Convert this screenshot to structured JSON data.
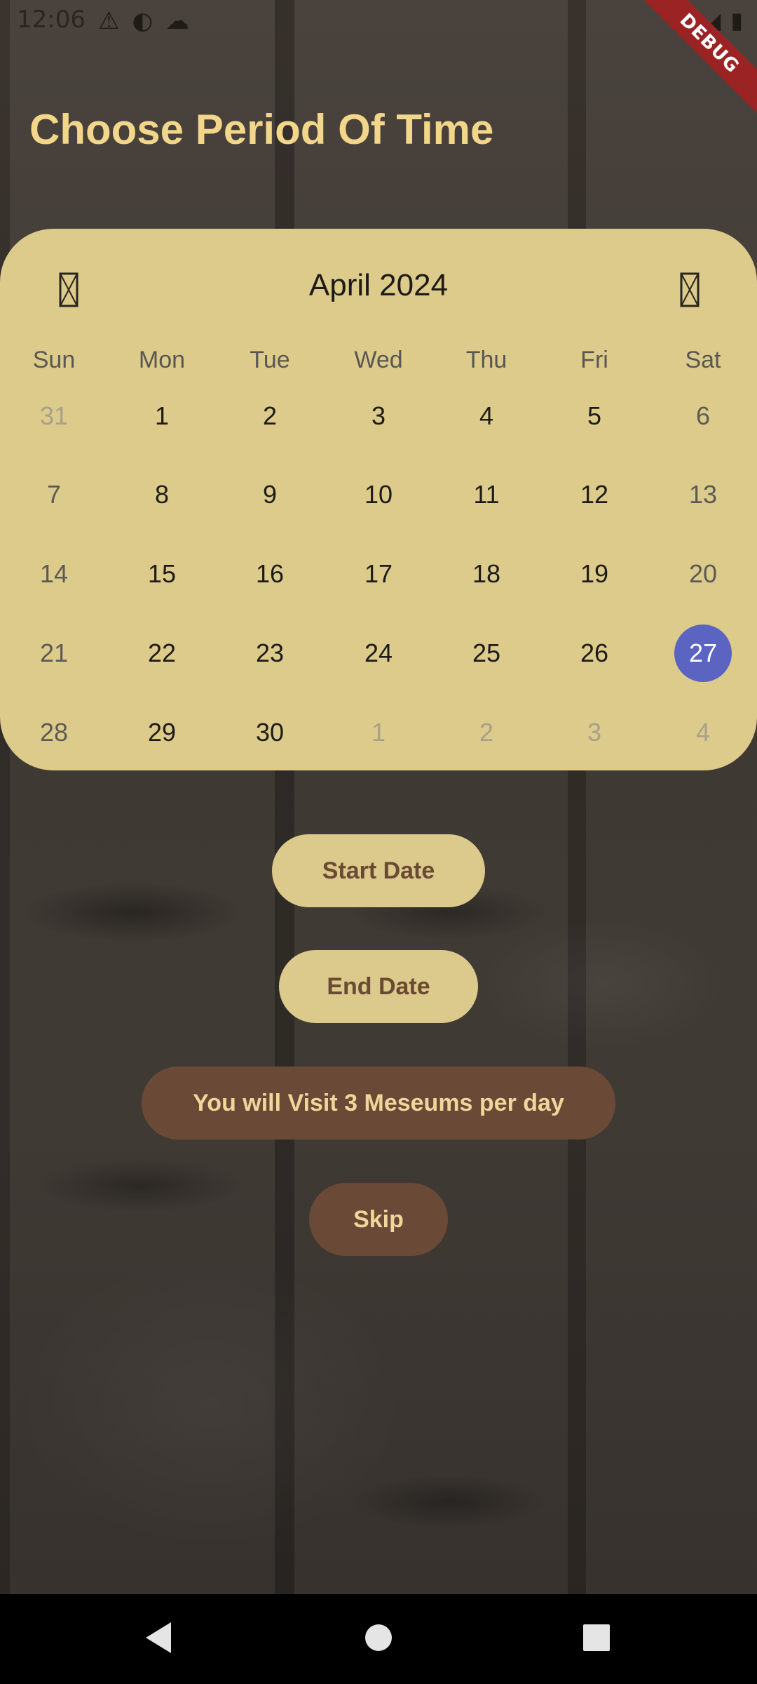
{
  "status_bar": {
    "time": "12:06",
    "left_icons": [
      "warning-icon",
      "data-saver-icon",
      "cloud-icon"
    ],
    "right_icons": [
      "wifi-icon",
      "signal-icon",
      "battery-icon"
    ]
  },
  "debug_banner": "DEBUG",
  "page": {
    "title": "Choose Period Of Time"
  },
  "calendar": {
    "month_label": "April 2024",
    "prev_icon": "chevron-left-icon",
    "next_icon": "chevron-right-icon",
    "weekdays": [
      "Sun",
      "Mon",
      "Tue",
      "Wed",
      "Thu",
      "Fri",
      "Sat"
    ],
    "weeks": [
      [
        "31",
        "1",
        "2",
        "3",
        "4",
        "5",
        "6"
      ],
      [
        "7",
        "8",
        "9",
        "10",
        "11",
        "12",
        "13"
      ],
      [
        "14",
        "15",
        "16",
        "17",
        "18",
        "19",
        "20"
      ],
      [
        "21",
        "22",
        "23",
        "24",
        "25",
        "26",
        "27"
      ],
      [
        "28",
        "29",
        "30",
        "1",
        "2",
        "3",
        "4"
      ]
    ],
    "selected_day": "27",
    "selected_color": "#5c64c2",
    "background_color": "#dccb8b"
  },
  "buttons": {
    "start_date": "Start Date",
    "end_date": "End Date",
    "visit_info": "You will Visit 3 Meseums per day",
    "skip": "Skip"
  },
  "nav_bar": {
    "icons": [
      "back-icon",
      "home-icon",
      "recents-icon"
    ]
  }
}
